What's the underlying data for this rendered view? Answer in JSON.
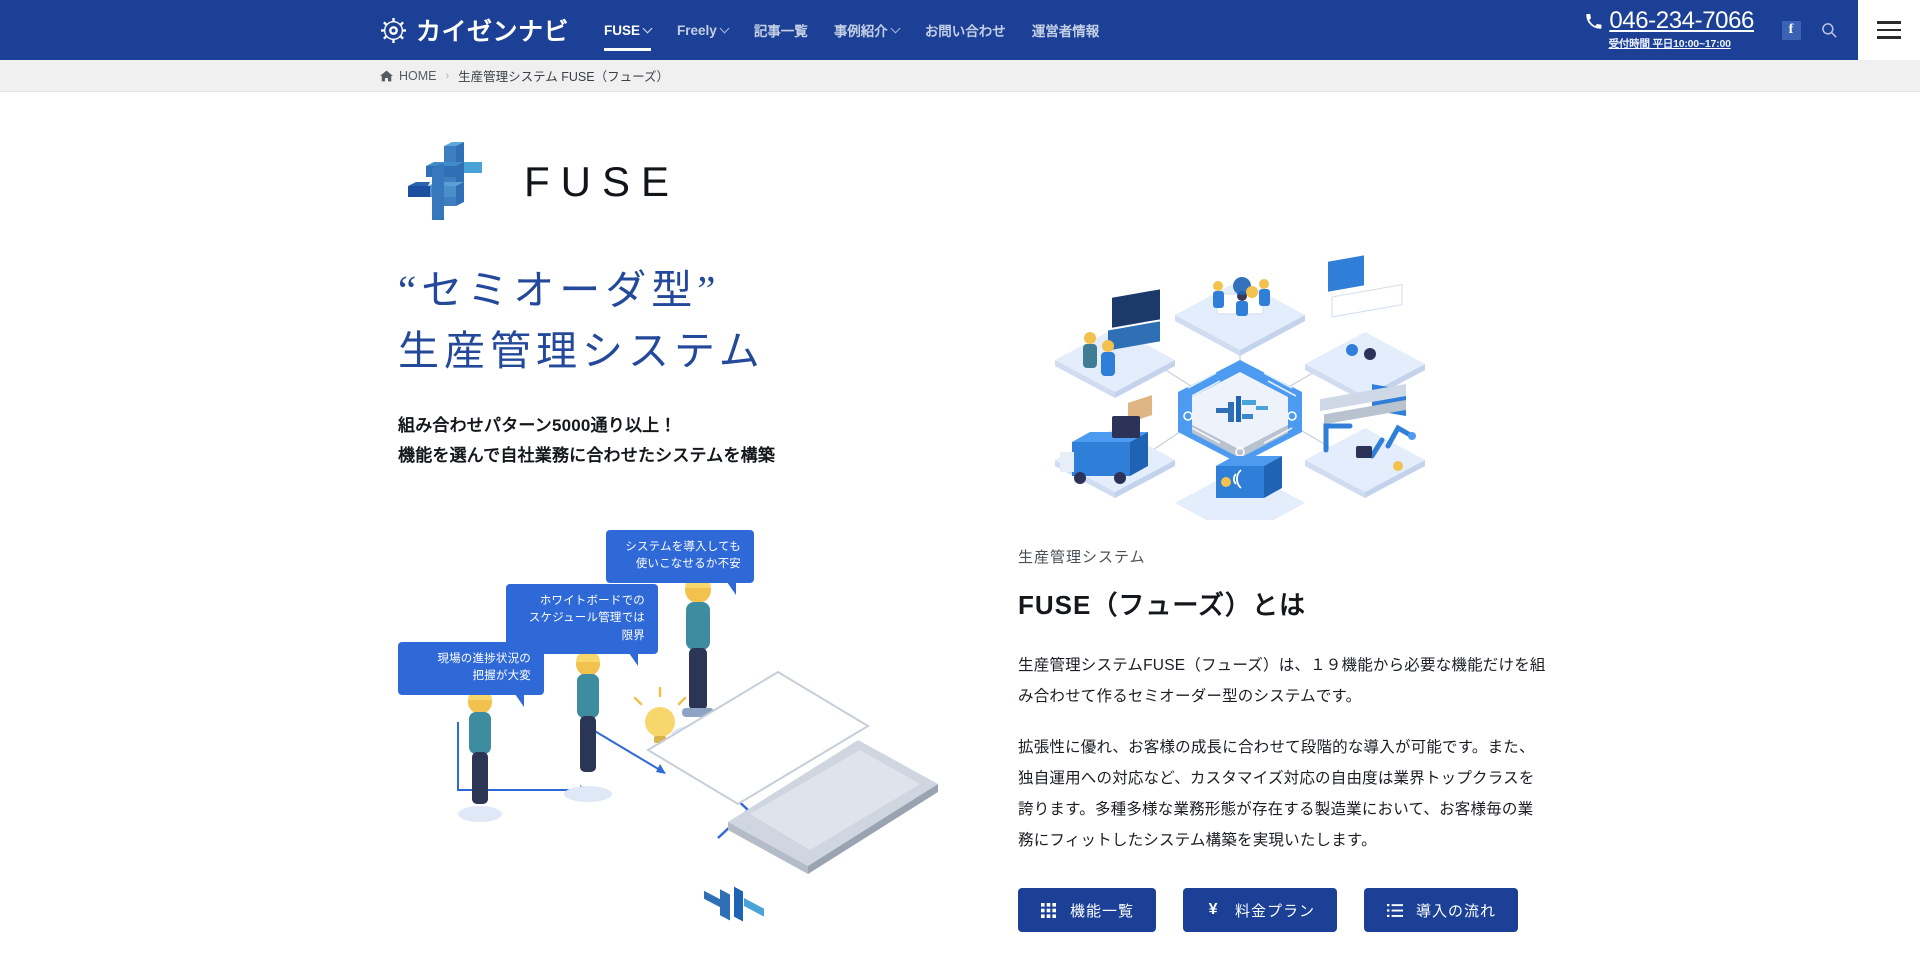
{
  "header": {
    "brand_name": "カイゼンナビ",
    "brand_icon": "gear-icon",
    "nav": [
      {
        "label": "FUSE",
        "has_caret": true,
        "active": true
      },
      {
        "label": "Freely",
        "has_caret": true,
        "active": false
      },
      {
        "label": "記事一覧",
        "has_caret": false,
        "active": false
      },
      {
        "label": "事例紹介",
        "has_caret": true,
        "active": false
      },
      {
        "label": "お問い合わせ",
        "has_caret": false,
        "active": false
      },
      {
        "label": "運営者情報",
        "has_caret": false,
        "active": false
      }
    ],
    "phone": "046-234-7066",
    "phone_hours": "受付時間 平日10:00~17:00",
    "phone_icon": "phone-icon",
    "facebook_icon": "facebook-icon",
    "facebook_glyph": "f",
    "search_icon": "search-icon",
    "menu_icon": "hamburger-menu-icon",
    "bg_color": "#1b4096"
  },
  "breadcrumb": {
    "home_label": "HOME",
    "separator": "›",
    "current": "生産管理システム FUSE（フューズ）"
  },
  "hero": {
    "logo_word": "FUSE",
    "logo_mark": "fuse-logo-mark",
    "title_line1": "“セミオーダ型”",
    "title_line2": "生産管理システム",
    "title_color": "#24499b",
    "sub_line1": "組み合わせパターン5000通り以上！",
    "sub_line2": "機能を選んで自社業務に合わせたシステムを構築",
    "illustration": "isometric-factory-network-illustration"
  },
  "main": {
    "eyebrow": "生産管理システム",
    "title": "FUSE（フューズ）とは",
    "paragraphs": [
      "生産管理システムFUSE（フューズ）は、１９機能から必要な機能だけを組み合わせて作るセミオーダー型のシステムです。",
      "拡張性に優れ、お客様の成長に合わせて段階的な導入が可能です。また、独自運用への対応など、カスタマイズ対応の自由度は業界トップクラスを誇ります。多種多様な業務形態が存在する製造業において、お客様毎の業務にフィットしたシステム構築を実現いたします。"
    ],
    "buttons": [
      {
        "label": "機能一覧",
        "icon": "grid-icon"
      },
      {
        "label": "料金プラン",
        "icon": "yen-icon"
      },
      {
        "label": "導入の流れ",
        "icon": "list-ordered-icon"
      }
    ],
    "button_color": "#1b4096",
    "illustration": "worker-problems-illustration",
    "bubbles": [
      "システムを導入しても\n使いこなせるか不安",
      "ホワイトボードでの\nスケジュール管理では限界",
      "現場の進捗状況の\n把握が大変"
    ]
  }
}
